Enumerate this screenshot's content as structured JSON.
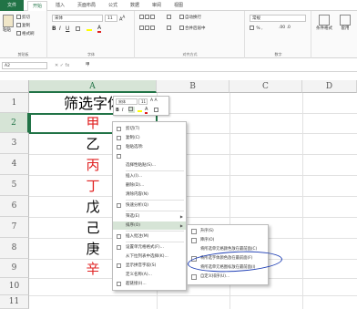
{
  "tabs": [
    "文件",
    "开始",
    "插入",
    "页面布局",
    "公式",
    "数据",
    "审阅",
    "视图"
  ],
  "ribbon": {
    "paste": "粘贴",
    "cut": "剪切",
    "copy": "复制",
    "format_painter": "格式刷",
    "clipboard_label": "剪贴板",
    "font_name": "宋体",
    "font_size": "11",
    "font_label": "字体",
    "wrap_text": "自动换行",
    "merge_center": "合并后居中",
    "alignment_label": "对齐方式",
    "number_format": "常规",
    "number_label": "数字",
    "conditional_format": "条件格式",
    "table_style": "套用"
  },
  "formula_bar": {
    "name_box": "A2",
    "value": "甲"
  },
  "columns": [
    "A",
    "B",
    "C",
    "D"
  ],
  "rows": [
    "1",
    "2",
    "3",
    "4",
    "5",
    "6",
    "7",
    "8",
    "9",
    "10",
    "11"
  ],
  "cells": [
    {
      "text": "筛选字体",
      "color": "#000000"
    },
    {
      "text": "甲",
      "color": "#e02020"
    },
    {
      "text": "乙",
      "color": "#000000"
    },
    {
      "text": "丙",
      "color": "#e02020"
    },
    {
      "text": "丁",
      "color": "#e02020"
    },
    {
      "text": "戊",
      "color": "#000000"
    },
    {
      "text": "己",
      "color": "#000000"
    },
    {
      "text": "庚",
      "color": "#000000"
    },
    {
      "text": "辛",
      "color": "#e02020"
    }
  ],
  "mini_toolbar": {
    "font": "宋体",
    "size": "11"
  },
  "context_menu": [
    "剪切(T)",
    "复制(C)",
    "粘贴选项:",
    "选择性粘贴(S)...",
    "插入(I)...",
    "删除(D)...",
    "清除内容(N)",
    "快速分析(Q)",
    "筛选(E)",
    "排序(O)",
    "插入批注(M)",
    "设置单元格格式(F)...",
    "从下拉列表中选择(K)...",
    "显示拼音字段(S)",
    "定义名称(A)...",
    "超链接(I)..."
  ],
  "submenu": [
    "升序(S)",
    "降序(O)",
    "将所选单元格颜色放在最前面(C)",
    "将所选字体颜色放在最前面(F)",
    "将所选单元格图标放在最前面(I)",
    "自定义排序(U)..."
  ],
  "accent": "#217346"
}
